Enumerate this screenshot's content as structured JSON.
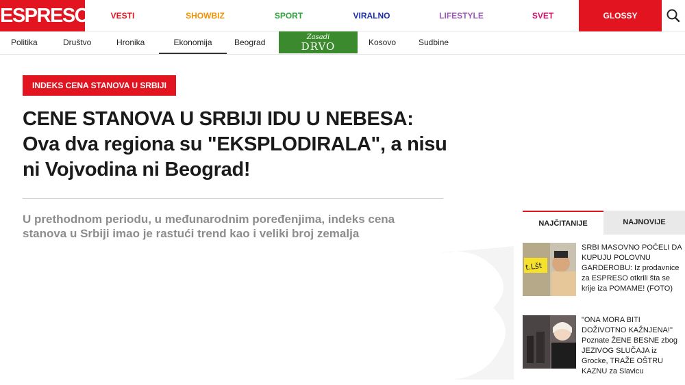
{
  "header": {
    "logo": "ESPRESO",
    "nav": [
      {
        "label": "VESTI",
        "color": "#e2141f"
      },
      {
        "label": "SHOWBIZ",
        "color": "#f39200"
      },
      {
        "label": "SPORT",
        "color": "#2ea43a"
      },
      {
        "label": "VIRALNO",
        "color": "#1b2fa8"
      },
      {
        "label": "LIFESTYLE",
        "color": "#9b59b6"
      },
      {
        "label": "SVET",
        "color": "#d4126e"
      }
    ],
    "glossy": "GLOSSY",
    "search_icon": "search-icon"
  },
  "subnav": {
    "items": [
      "Politika",
      "Društvo",
      "Hronika",
      "Ekonomija",
      "Beograd",
      "Kosovo",
      "Sudbine"
    ],
    "active": "Ekonomija",
    "drvo_line1": "Zasadi",
    "drvo_line2": "DRVO"
  },
  "article": {
    "tag": "INDEKS CENA STANOVA U SRBIJI",
    "title": "CENE STANOVA U SRBIJI IDU U NEBESA: Ova dva regiona su \"EKSPLODIRALA\", a nisu ni Vojvodina ni Beograd!",
    "lead": "U prethodnom periodu, u međunarodnim poređenjima, indeks cena stanova u Srbiji imao je rastući trend kao i veliki broj zemalja"
  },
  "sidebar": {
    "tabs": [
      "NAJČITANIJE",
      "NAJNOVIJE"
    ],
    "items": [
      {
        "title": "SRBI MASOVNO POČELI DA KUPUJU POLOVNU GARDEROBU: Iz prodavnice za ESPRESO otkrili šta se krije iza POMAME! (FOTO)"
      },
      {
        "title": "\"ONA MORA BITI DOŽIVOTNO KAŽNJENA!\" Poznate ŽENE BESNE zbog JEZIVOG SLUČAJA iz Grocke, TRAŽE OŠTRU KAZNU za Slavicu"
      }
    ]
  },
  "colors": {
    "brand_red": "#e2141f",
    "drvo_green": "#3b8a2d"
  }
}
